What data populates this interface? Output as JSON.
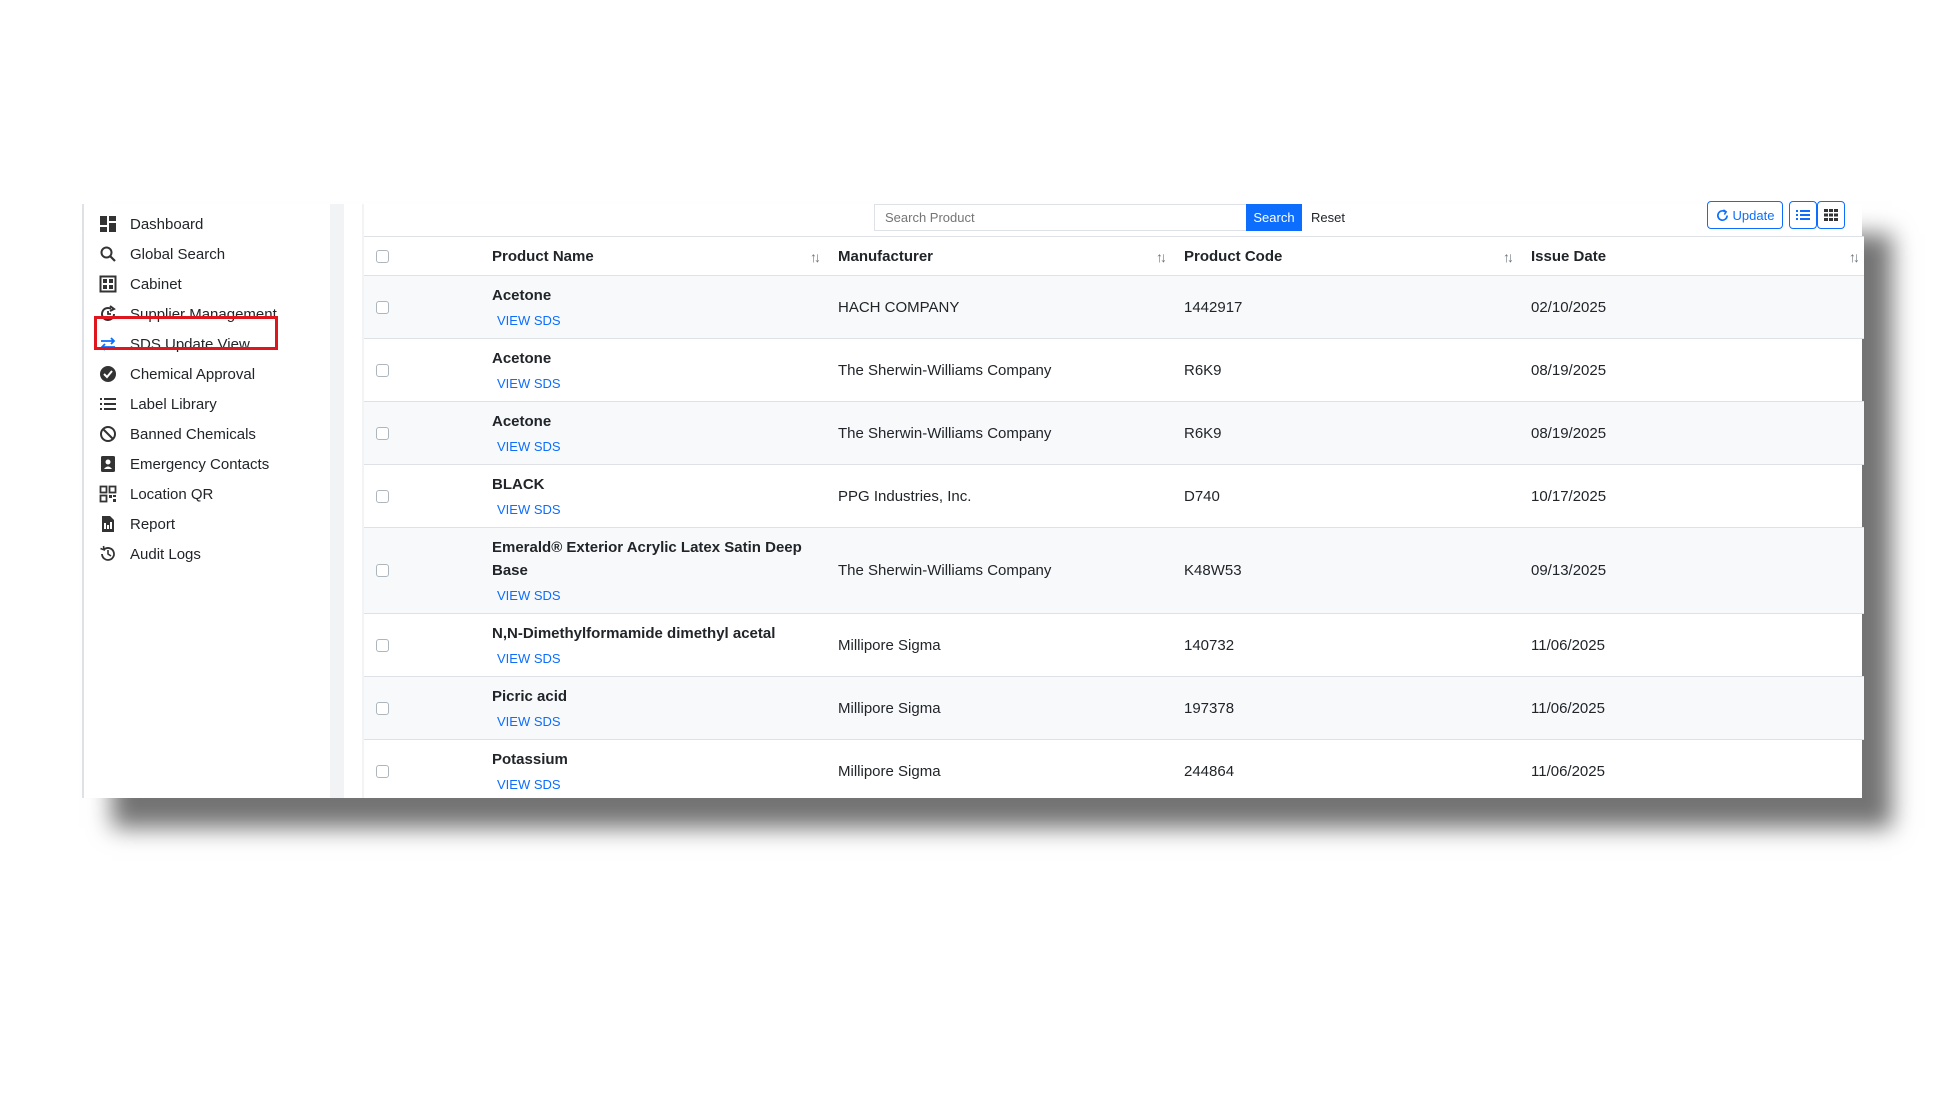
{
  "sidebar": {
    "items": [
      {
        "label": "Dashboard",
        "icon": "dashboard-icon"
      },
      {
        "label": "Global Search",
        "icon": "search-icon"
      },
      {
        "label": "Cabinet",
        "icon": "cabinet-icon"
      },
      {
        "label": "Supplier Management",
        "icon": "supplier-icon"
      },
      {
        "label": "SDS Update View",
        "icon": "swap-arrows-icon"
      },
      {
        "label": "Chemical Approval",
        "icon": "check-badge-icon"
      },
      {
        "label": "Label Library",
        "icon": "list-icon"
      },
      {
        "label": "Banned Chemicals",
        "icon": "ban-icon"
      },
      {
        "label": "Emergency Contacts",
        "icon": "contact-icon"
      },
      {
        "label": "Location QR",
        "icon": "qr-icon"
      },
      {
        "label": "Report",
        "icon": "report-icon"
      },
      {
        "label": "Audit Logs",
        "icon": "history-icon"
      }
    ],
    "highlighted": "SDS Update View",
    "highlight_color": "#e0161f"
  },
  "toolbar": {
    "search_placeholder": "Search Product",
    "search_label": "Search",
    "reset_label": "Reset",
    "update_label": "Update",
    "accent": "#0d6efd"
  },
  "table": {
    "columns": [
      "Product Name",
      "Manufacturer",
      "Product Code",
      "Issue Date"
    ],
    "view_sds_label": "VIEW SDS",
    "rows": [
      {
        "name": "Acetone",
        "manufacturer": "HACH COMPANY",
        "code": "1442917",
        "date": "02/10/2025"
      },
      {
        "name": "Acetone",
        "manufacturer": "The Sherwin-Williams Company",
        "code": "R6K9",
        "date": "08/19/2025"
      },
      {
        "name": "Acetone",
        "manufacturer": "The Sherwin-Williams Company",
        "code": "R6K9",
        "date": "08/19/2025"
      },
      {
        "name": "BLACK",
        "manufacturer": "PPG Industries, Inc.",
        "code": "D740",
        "date": "10/17/2025"
      },
      {
        "name": "Emerald® Exterior Acrylic Latex Satin Deep Base",
        "manufacturer": "The Sherwin-Williams Company",
        "code": "K48W53",
        "date": "09/13/2025"
      },
      {
        "name": "N,N-Dimethylformamide dimethyl acetal",
        "manufacturer": "Millipore Sigma",
        "code": "140732",
        "date": "11/06/2025"
      },
      {
        "name": "Picric acid",
        "manufacturer": "Millipore Sigma",
        "code": "197378",
        "date": "11/06/2025"
      },
      {
        "name": "Potassium",
        "manufacturer": "Millipore Sigma",
        "code": "244864",
        "date": "11/06/2025"
      }
    ]
  }
}
